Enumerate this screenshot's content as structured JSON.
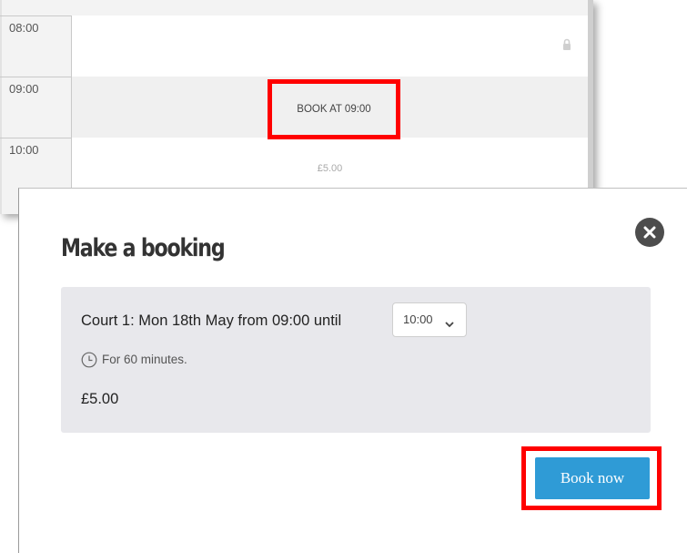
{
  "schedule": {
    "rows": [
      {
        "time": "08:00"
      },
      {
        "time": "09:00",
        "slot_button": "BOOK AT 09:00"
      },
      {
        "time": "10:00",
        "price": "£5.00"
      }
    ]
  },
  "modal": {
    "title": "Make a booking",
    "description": "Court 1: Mon 18th May from 09:00 until",
    "end_time_selected": "10:00",
    "duration_text": "For 60 minutes.",
    "price": "£5.00",
    "book_button": "Book now"
  },
  "colors": {
    "highlight": "#ff0000",
    "primary_button": "#2f9bd6",
    "panel_bg": "#e8e8ec",
    "close_button": "#4d4d4d"
  },
  "icons": [
    "lock-icon",
    "close-icon",
    "clock-icon",
    "chevron-down-icon"
  ]
}
